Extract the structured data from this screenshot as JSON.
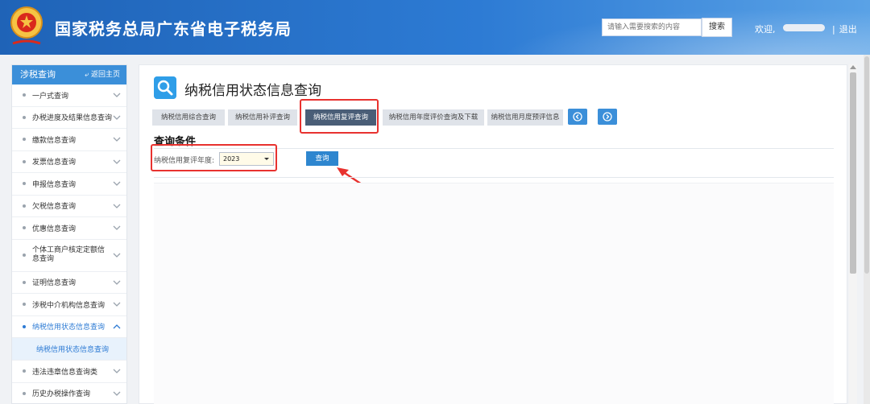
{
  "header": {
    "title": "国家税务总局广东省电子税务局",
    "emblem_icon": "tax-emblem-icon",
    "search_placeholder": "请输入需要搜索的内容",
    "search_button": "搜索",
    "welcome": "欢迎,",
    "logout": "退出",
    "logout_sep": "|"
  },
  "sidebar": {
    "title": "涉税查询",
    "back_label": "返回主页",
    "items": [
      {
        "label": "一户式查询",
        "expanded": false
      },
      {
        "label": "办税进度及结果信息查询",
        "expanded": false
      },
      {
        "label": "缴款信息查询",
        "expanded": false
      },
      {
        "label": "发票信息查询",
        "expanded": false
      },
      {
        "label": "申报信息查询",
        "expanded": false
      },
      {
        "label": "欠税信息查询",
        "expanded": false
      },
      {
        "label": "优惠信息查询",
        "expanded": false
      },
      {
        "label": "个体工商户核定定额信息查询",
        "expanded": false
      },
      {
        "label": "证明信息查询",
        "expanded": false
      },
      {
        "label": "涉税中介机构信息查询",
        "expanded": false
      },
      {
        "label": "纳税信用状态信息查询",
        "expanded": true
      },
      {
        "label": "违法违章信息查询类",
        "expanded": false
      },
      {
        "label": "历史办税操作查询",
        "expanded": false
      }
    ],
    "sub_item": "纳税信用状态信息查询"
  },
  "main": {
    "title": "纳税信用状态信息查询",
    "tabs": [
      {
        "label": "纳税信用综合查询",
        "active": false
      },
      {
        "label": "纳税信用补评查询",
        "active": false
      },
      {
        "label": "纳税信用复评查询",
        "active": true
      },
      {
        "label": "纳税信用年度评价查询及下载",
        "active": false
      },
      {
        "label": "纳税信用月度预评信息",
        "active": false
      }
    ],
    "condition_title": "查询条件",
    "field_label": "纳税信用复评年度:",
    "year_value": "2023",
    "query_button": "查询"
  },
  "colors": {
    "header": "#2d7bd4",
    "accent": "#3b8fd9",
    "active_tab": "#4a5e77",
    "highlight": "#e8322f"
  }
}
